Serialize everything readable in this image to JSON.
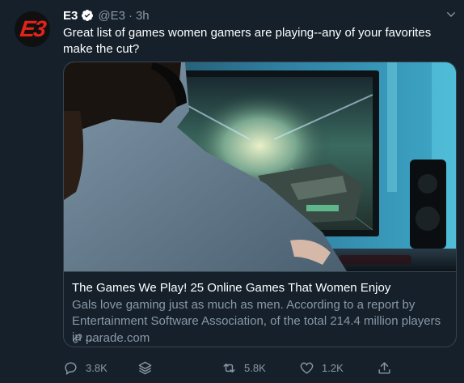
{
  "tweet": {
    "avatar_text": "E3",
    "name": "E3",
    "handle": "@E3",
    "separator": "·",
    "time": "3h",
    "text": "Great list of games women gamers are playing--any of your favorites make the cut?"
  },
  "card": {
    "title": "The Games We Play! 25 Online Games That Women Enjoy",
    "description": "Gals love gaming just as much as men. According to a report by Entertainment Software Association, of the total 214.4 million players in ...",
    "domain": "parade.com"
  },
  "actions": {
    "reply_count": "3.8K",
    "retweet_count": "5.8K",
    "like_count": "1.2K"
  },
  "icons": {
    "verified": "verified-badge-icon",
    "caret": "chevron-down-icon",
    "reply": "reply-icon",
    "layers": "layers-icon",
    "retweet": "retweet-icon",
    "like": "heart-icon",
    "share": "share-icon",
    "link": "link-icon"
  },
  "colors": {
    "background": "#15202b",
    "secondary_text": "#8899a6",
    "border": "#38444d",
    "brand_red": "#e2231a"
  }
}
